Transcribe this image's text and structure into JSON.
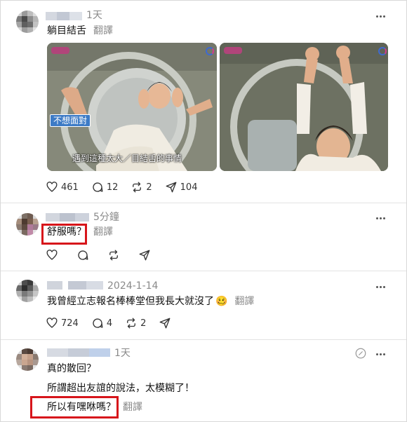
{
  "posts": [
    {
      "time": "1天",
      "text": "躺目結舌",
      "translate": "翻譯",
      "images": [
        {
          "caption_badge": "不想面對",
          "subtitle": "遇到這種太大／目結舌的事情"
        },
        {}
      ],
      "stats": {
        "likes": "461",
        "comments": "12",
        "reposts": "2",
        "shares": "104"
      }
    },
    {
      "time": "5分鐘",
      "text": "舒服嗎？",
      "translate": "翻譯"
    },
    {
      "time": "2024-1-14",
      "text": "我曾經立志報名棒棒堂但我長大就沒了",
      "emoji": "🥴",
      "translate": "翻譯",
      "stats": {
        "likes": "724",
        "comments": "4",
        "reposts": "2"
      }
    },
    {
      "time": "1天",
      "lines": [
        "真的散回？",
        "所謂超出友誼的說法，太模糊了！",
        "所以有嘿咻嗎？"
      ],
      "translate": "翻譯"
    }
  ],
  "colors": {
    "highlight": "#d7151b",
    "meta_gray": "#8a8a8a",
    "divider": "#e3e3e3"
  },
  "icons": [
    "heart-icon",
    "comment-icon",
    "repost-icon",
    "share-icon",
    "more-icon",
    "edit-icon"
  ]
}
